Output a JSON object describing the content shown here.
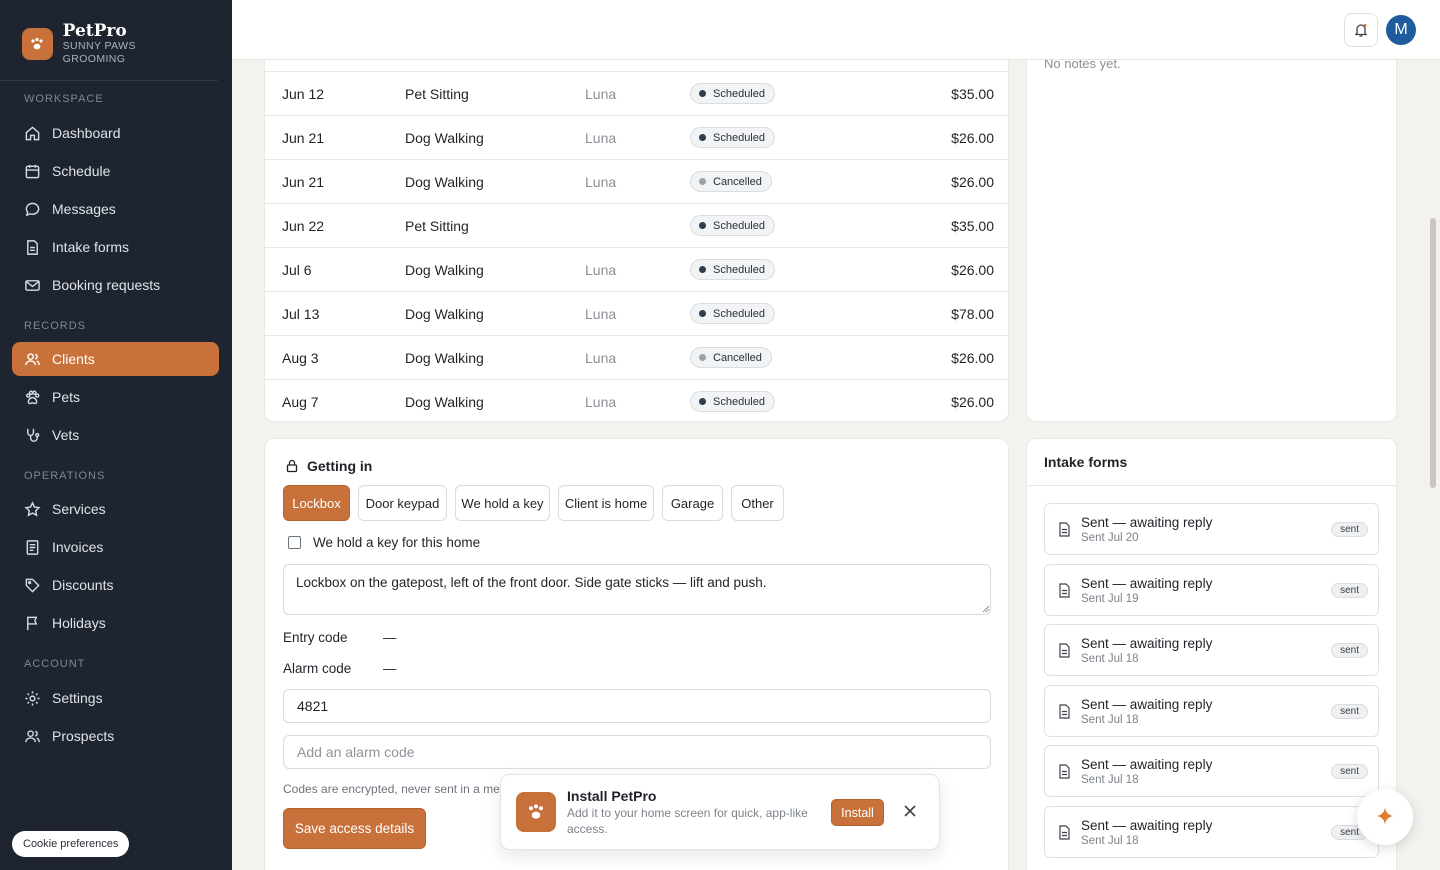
{
  "brand": {
    "name": "PetPro",
    "subtitle": "SUNNY PAWS GROOMING"
  },
  "sidebar": {
    "sections": [
      {
        "label": "WORKSPACE"
      },
      {
        "label": "RECORDS"
      },
      {
        "label": "OPERATIONS"
      },
      {
        "label": "ACCOUNT"
      }
    ],
    "items": [
      {
        "label": "Dashboard",
        "icon": "home-icon"
      },
      {
        "label": "Schedule",
        "icon": "calendar-icon"
      },
      {
        "label": "Messages",
        "icon": "chat-icon"
      },
      {
        "label": "Intake forms",
        "icon": "document-icon"
      },
      {
        "label": "Booking requests",
        "icon": "mail-icon"
      },
      {
        "label": "Clients",
        "icon": "users-icon",
        "active": true
      },
      {
        "label": "Pets",
        "icon": "paw-icon"
      },
      {
        "label": "Vets",
        "icon": "stethoscope-icon"
      },
      {
        "label": "Services",
        "icon": "star-icon"
      },
      {
        "label": "Invoices",
        "icon": "invoice-icon"
      },
      {
        "label": "Discounts",
        "icon": "tag-icon"
      },
      {
        "label": "Holidays",
        "icon": "flag-icon"
      },
      {
        "label": "Settings",
        "icon": "gear-icon"
      },
      {
        "label": "Prospects",
        "icon": "users-icon"
      }
    ],
    "cookie_label": "Cookie preferences"
  },
  "topbar": {
    "avatar_initial": "M"
  },
  "visits": [
    {
      "date": "Jun 12",
      "service": "Pet Sitting",
      "pet": "Luna",
      "status": "Scheduled",
      "amount": "$35.00"
    },
    {
      "date": "Jun 21",
      "service": "Dog Walking",
      "pet": "Luna",
      "status": "Scheduled",
      "amount": "$26.00"
    },
    {
      "date": "Jun 21",
      "service": "Dog Walking",
      "pet": "Luna",
      "status": "Cancelled",
      "amount": "$26.00"
    },
    {
      "date": "Jun 22",
      "service": "Pet Sitting",
      "pet": "",
      "status": "Scheduled",
      "amount": "$35.00"
    },
    {
      "date": "Jul 6",
      "service": "Dog Walking",
      "pet": "Luna",
      "status": "Scheduled",
      "amount": "$26.00"
    },
    {
      "date": "Jul 13",
      "service": "Dog Walking",
      "pet": "Luna",
      "status": "Scheduled",
      "amount": "$78.00"
    },
    {
      "date": "Aug 3",
      "service": "Dog Walking",
      "pet": "Luna",
      "status": "Cancelled",
      "amount": "$26.00"
    },
    {
      "date": "Aug 7",
      "service": "Dog Walking",
      "pet": "Luna",
      "status": "Scheduled",
      "amount": "$26.00"
    }
  ],
  "status_colors": {
    "Scheduled": "#2d3e50",
    "Cancelled": "#9aa1a9"
  },
  "notes": {
    "empty_text": "No notes yet."
  },
  "access": {
    "title": "Getting in",
    "methods": [
      "Lockbox",
      "Door keypad",
      "We hold a key",
      "Client is home",
      "Garage",
      "Other"
    ],
    "selected_method": "Lockbox",
    "hold_key_label": "We hold a key for this home",
    "hold_key_checked": false,
    "instructions": "Lockbox on the gatepost, left of the front door. Side gate sticks — lift and push.",
    "entry_code_label": "Entry code",
    "entry_code_value": "—",
    "alarm_code_label": "Alarm code",
    "alarm_code_value": "—",
    "entry_code_input": "4821",
    "alarm_code_placeholder": "Add an alarm code",
    "help_text": "Codes are encrypted, never sent in a mess",
    "save_label": "Save access details"
  },
  "intake": {
    "title": "Intake forms",
    "forms": [
      {
        "title": "Sent — awaiting reply",
        "sub": "Sent Jul 20",
        "tag": "sent"
      },
      {
        "title": "Sent — awaiting reply",
        "sub": "Sent Jul 19",
        "tag": "sent"
      },
      {
        "title": "Sent — awaiting reply",
        "sub": "Sent Jul 18",
        "tag": "sent"
      },
      {
        "title": "Sent — awaiting reply",
        "sub": "Sent Jul 18",
        "tag": "sent"
      },
      {
        "title": "Sent — awaiting reply",
        "sub": "Sent Jul 18",
        "tag": "sent"
      },
      {
        "title": "Sent — awaiting reply",
        "sub": "Sent Jul 18",
        "tag": "sent"
      }
    ]
  },
  "install_prompt": {
    "title": "Install PetPro",
    "description": "Add it to your home screen for quick, app-like access.",
    "install_label": "Install"
  },
  "colors": {
    "accent": "#c8713a",
    "sidebar_bg": "#1e2530"
  }
}
